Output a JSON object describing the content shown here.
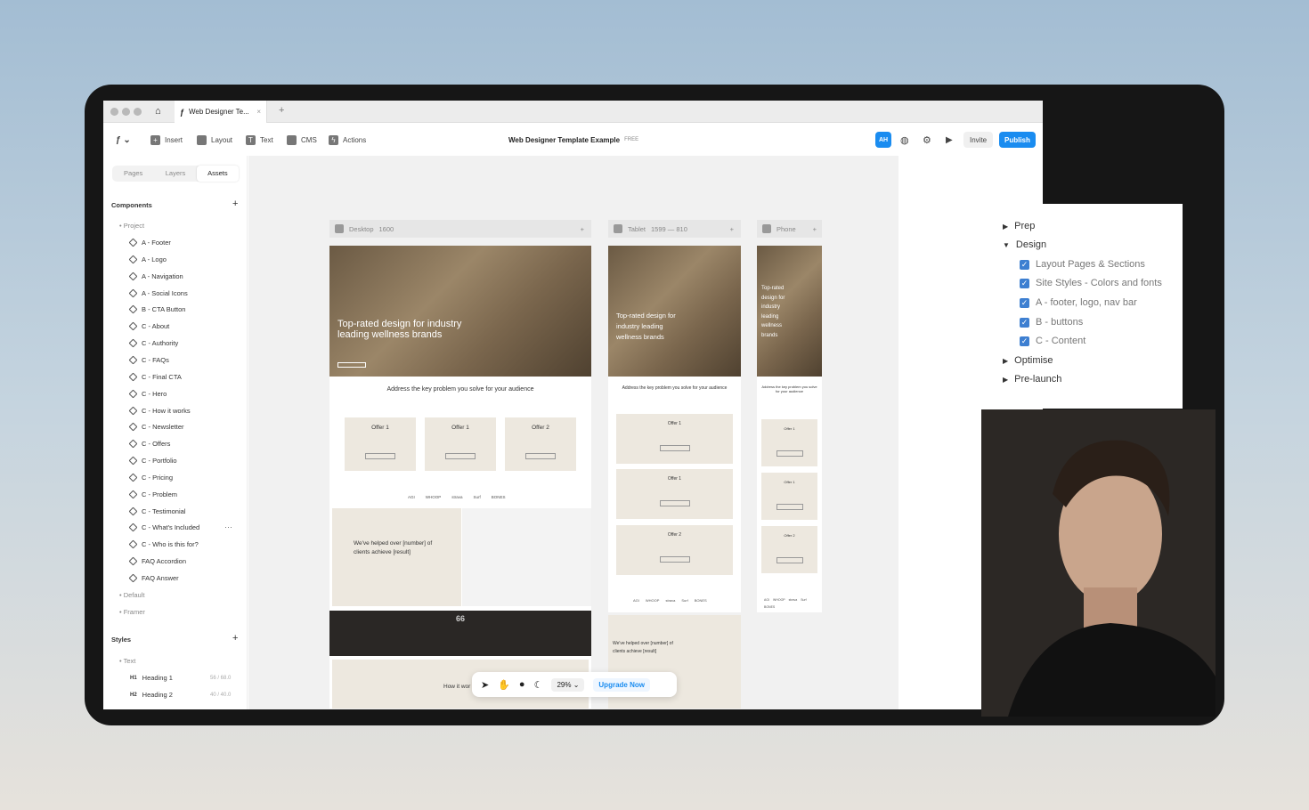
{
  "browser": {
    "tab_title": "Web Designer Te...",
    "tab_close": "×",
    "new_tab": "+"
  },
  "toolbar": {
    "insert": "Insert",
    "layout": "Layout",
    "text": "Text",
    "cms": "CMS",
    "actions": "Actions",
    "project_title": "Web Designer Template Example",
    "plan_badge": "FREE",
    "avatar": "AH",
    "invite": "Invite",
    "publish": "Publish"
  },
  "sidebar": {
    "tabs": [
      "Pages",
      "Layers",
      "Assets"
    ],
    "components_heading": "Components",
    "project_group": "Project",
    "components": [
      "A - Footer",
      "A - Logo",
      "A - Navigation",
      "A - Social Icons",
      "B - CTA Button",
      "C - About",
      "C - Authority",
      "C - FAQs",
      "C - Final CTA",
      "C - Hero",
      "C - How it works",
      "C - Newsletter",
      "C - Offers",
      "C - Portfolio",
      "C - Pricing",
      "C - Problem",
      "C - Testimonial",
      "C - What's Included",
      "C - Who is this for?",
      "FAQ Accordion",
      "FAQ Answer"
    ],
    "default_group": "Default",
    "framer_group": "Framer",
    "styles_heading": "Styles",
    "text_group": "Text",
    "styles": [
      {
        "tag": "H1",
        "name": "Heading 1",
        "size": "56 / 68.0"
      },
      {
        "tag": "H2",
        "name": "Heading 2",
        "size": "40 / 40.0"
      }
    ],
    "more_icon": "···"
  },
  "canvas": {
    "desktop": {
      "label": "Desktop",
      "size": "1600"
    },
    "tablet": {
      "label": "Tablet",
      "size": "1599 — 810"
    },
    "phone": {
      "label": "Phone"
    },
    "hero_desktop": "Top-rated design for industry leading wellness brands",
    "hero_tablet": "Top-rated design for industry leading wellness brands",
    "hero_phone": "Top-rated design for industry leading wellness brands",
    "problem_desktop": "Address the key problem you solve for your audience",
    "problem_tablet": "Address the key problem you solve for your audience",
    "problem_phone": "Address the key problem you solve for your audience",
    "offers": [
      "Offer 1",
      "Offer 1",
      "Offer 2"
    ],
    "logos": [
      "AGI",
      "WHOOP",
      "strava",
      "Surf",
      "BONES"
    ],
    "helped": "We've helped over [number] of clients achieve [result]",
    "quote_mark": "66",
    "how_it_works": "How it wor",
    "zoom": "29%",
    "upgrade": "Upgrade Now"
  },
  "checklist": {
    "items": [
      {
        "label": "Prep",
        "expanded": false
      },
      {
        "label": "Design",
        "expanded": true
      },
      {
        "label": "Optimise",
        "expanded": false
      },
      {
        "label": "Pre-launch",
        "expanded": false
      }
    ],
    "design_subitems": [
      "Layout Pages & Sections",
      "Site Styles - Colors and fonts",
      "A - footer, logo, nav bar",
      "B - buttons",
      "C - Content"
    ]
  },
  "colors": {
    "accent": "#1a8cf0",
    "checkbox": "#3d7fd1",
    "hero_tone": "#7a664d",
    "offer_card": "#ede8df"
  }
}
